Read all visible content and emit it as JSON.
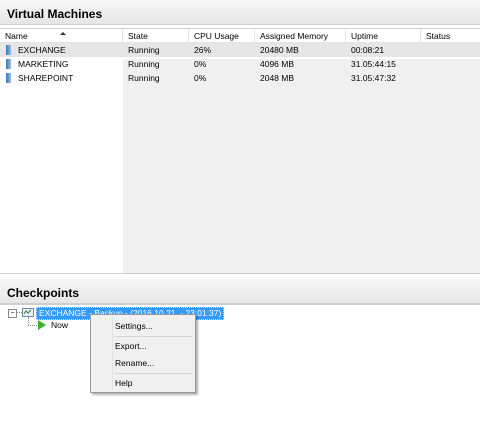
{
  "vm_panel": {
    "title": "Virtual Machines",
    "columns": [
      "Name",
      "State",
      "CPU Usage",
      "Assigned Memory",
      "Uptime",
      "Status"
    ],
    "rows": [
      {
        "name": "EXCHANGE",
        "state": "Running",
        "cpu": "26%",
        "memory": "20480 MB",
        "uptime": "00:08:21",
        "status": ""
      },
      {
        "name": "MARKETING",
        "state": "Running",
        "cpu": "0%",
        "memory": "4096 MB",
        "uptime": "31.05:44:15",
        "status": ""
      },
      {
        "name": "SHAREPOINT",
        "state": "Running",
        "cpu": "0%",
        "memory": "2048 MB",
        "uptime": "31.05:47:32",
        "status": ""
      }
    ]
  },
  "checkpoints_panel": {
    "title": "Checkpoints",
    "tree_toggle": "−",
    "checkpoint_label": "EXCHANGE - Backup - (2016.10.21. - 23:01:37)",
    "now_label": "Now"
  },
  "context_menu": {
    "items": [
      "Settings...",
      "Export...",
      "Rename...",
      "Help"
    ]
  },
  "colors": {
    "selection": "#3399ff",
    "now_icon": "#3fae33",
    "vm_icon": "#3a78b5"
  }
}
